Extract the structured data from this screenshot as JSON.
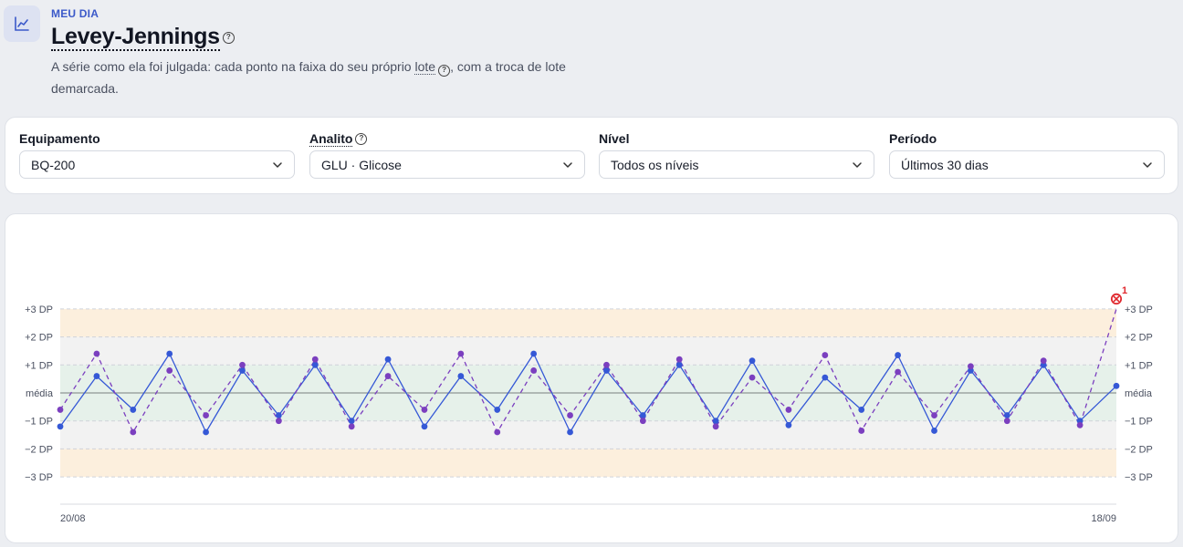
{
  "header": {
    "eyebrow": "MEU DIA",
    "title": "Levey-Jennings",
    "subtitle_pre": "A série como ela foi julgada: cada ponto na faixa do seu próprio ",
    "subtitle_term": "lote",
    "subtitle_post": ", com a troca de lote demarcada.",
    "icons": {
      "app": "line-chart-icon",
      "help": "help-circle-icon"
    }
  },
  "filters": {
    "equipamento": {
      "label": "Equipamento",
      "value": "BQ-200"
    },
    "analito": {
      "label": "Analito",
      "value": "GLU · Glicose"
    },
    "nivel": {
      "label": "Nível",
      "value": "Todos os níveis"
    },
    "periodo": {
      "label": "Período",
      "value": "Últimos 30 dias"
    }
  },
  "colors": {
    "series_blue": "#3558d6",
    "series_purple": "#7b3fbf",
    "band_1sd": "#e6f1ea",
    "band_2sd": "#f2f2f2",
    "band_3sd": "#fcefdd",
    "violation": "#e0282e"
  },
  "chart_data": {
    "type": "line",
    "ylim": [
      -3,
      3
    ],
    "y_ticks": [
      {
        "v": 3,
        "label": "+3 DP"
      },
      {
        "v": 2,
        "label": "+2 DP"
      },
      {
        "v": 1,
        "label": "+1 DP"
      },
      {
        "v": 0,
        "label": "média"
      },
      {
        "v": -1,
        "label": "−1 DP"
      },
      {
        "v": -2,
        "label": "−2 DP"
      },
      {
        "v": -3,
        "label": "−3 DP"
      }
    ],
    "x_labels": {
      "start": "20/08",
      "end": "18/09"
    },
    "series": [
      {
        "color_key": "series_blue",
        "style": "solid",
        "values": [
          -1.2,
          0.6,
          -0.6,
          1.4,
          -1.4,
          0.8,
          -0.8,
          1.0,
          -1.0,
          1.2,
          -1.2,
          0.6,
          -0.6,
          1.4,
          -1.4,
          0.8,
          -0.8,
          1.0,
          -1.0,
          1.15,
          -1.15,
          0.55,
          -0.6,
          1.35,
          -1.35,
          0.8,
          -0.8,
          1.0,
          -1.0,
          0.25
        ]
      },
      {
        "color_key": "series_purple",
        "style": "dashed",
        "values": [
          -0.6,
          1.4,
          -1.4,
          0.8,
          -0.8,
          1.0,
          -1.0,
          1.2,
          -1.2,
          0.6,
          -0.6,
          1.4,
          -1.4,
          0.8,
          -0.8,
          1.0,
          -1.0,
          1.2,
          -1.2,
          0.55,
          -0.6,
          1.35,
          -1.35,
          0.75,
          -0.8,
          0.95,
          -1.0,
          1.15,
          -1.15,
          3.0
        ]
      }
    ],
    "violations": [
      {
        "series": 1,
        "index": 29,
        "label": "1"
      }
    ]
  }
}
